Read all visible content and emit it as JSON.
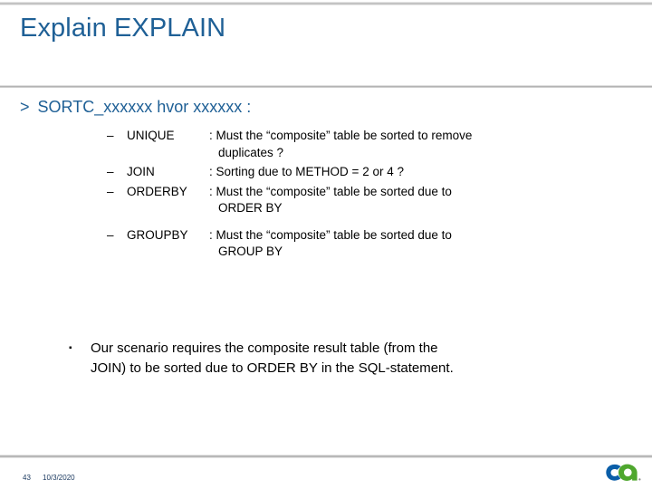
{
  "slide": {
    "title": "Explain EXPLAIN",
    "lead_marker": ">",
    "lead_text": "SORTC_xxxxxx hvor xxxxxx :",
    "title_color": "#1F6096",
    "rule_color": "#b2b2b2"
  },
  "sub_items": [
    {
      "dash": "–",
      "key": "UNIQUE",
      "value": ": Must the “composite” table be sorted to remove",
      "value_cont": "duplicates ?"
    },
    {
      "dash": "–",
      "key": "JOIN",
      "value": ": Sorting due to METHOD = 2 or 4 ?",
      "value_cont": ""
    },
    {
      "dash": "–",
      "key": "ORDERBY",
      "value": ": Must the “composite” table be sorted due to",
      "value_cont": "ORDER BY"
    },
    {
      "dash": "–",
      "key": "GROUPBY",
      "value": ": Must the “composite” table be sorted due to",
      "value_cont": "GROUP BY"
    }
  ],
  "summary": {
    "bullet": "▪",
    "line1": "Our scenario requires the composite result table (from the",
    "line2": "JOIN) to be sorted due to ORDER BY in the SQL-statement."
  },
  "footer": {
    "page_number": "43",
    "date": "10/3/2020",
    "text_color": "#17365D",
    "logo_name": "ca-logo",
    "logo_blue": "#0A5EA8",
    "logo_green": "#4FA72E"
  }
}
